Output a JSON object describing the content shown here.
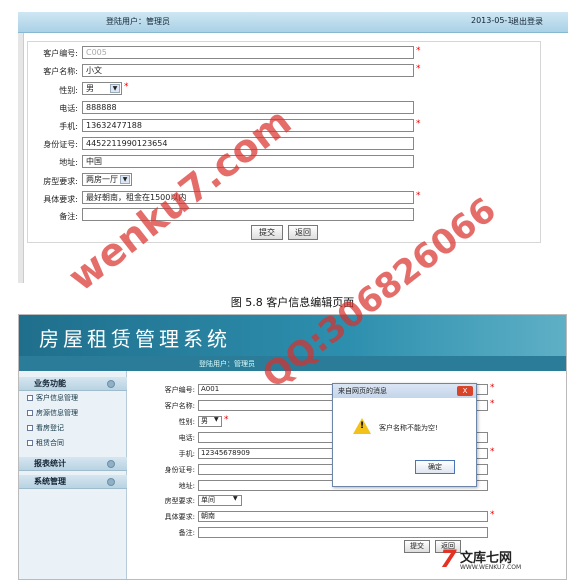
{
  "top_screenshot": {
    "header": {
      "user": "登陆用户：管理员",
      "date": "2013-05-1",
      "logout": "退出登录"
    },
    "fields": [
      {
        "label": "客户编号:",
        "value": "C005",
        "required": true
      },
      {
        "label": "客户名称:",
        "value": "小文",
        "required": true
      },
      {
        "label": "性别:",
        "value": "男",
        "required": true,
        "type": "select"
      },
      {
        "label": "电话:",
        "value": "888888",
        "required": false
      },
      {
        "label": "手机:",
        "value": "13632477188",
        "required": true
      },
      {
        "label": "身份证号:",
        "value": "4452211990123654",
        "required": false
      },
      {
        "label": "地址:",
        "value": "中国",
        "required": false
      },
      {
        "label": "房型要求:",
        "value": "两房一厅",
        "required": false,
        "type": "select"
      },
      {
        "label": "具体要求:",
        "value": "最好朝南，租金在1500以内",
        "required": true
      },
      {
        "label": "备注:",
        "value": "",
        "required": false
      }
    ],
    "buttons": {
      "submit": "提交",
      "back": "返回"
    }
  },
  "caption": "图 5.8 客户信息编辑页面",
  "bottom_screenshot": {
    "app_title": "房屋租赁管理系统",
    "user": "登陆用户：管理员",
    "sidebar": {
      "sections": [
        {
          "label": "业务功能",
          "items": [
            "客户信息管理",
            "房源信息管理",
            "看房登记",
            "租赁合同"
          ]
        },
        {
          "label": "报表统计",
          "items": []
        },
        {
          "label": "系统管理",
          "items": []
        }
      ]
    },
    "fields": [
      {
        "label": "客户编号:",
        "value": "A001",
        "required": true
      },
      {
        "label": "客户名称:",
        "value": "",
        "required": true
      },
      {
        "label": "性别:",
        "value": "男",
        "required": true
      },
      {
        "label": "电话:",
        "value": "",
        "required": false
      },
      {
        "label": "手机:",
        "value": "12345678909",
        "required": true
      },
      {
        "label": "身份证号:",
        "value": "",
        "required": false
      },
      {
        "label": "地址:",
        "value": "",
        "required": false
      },
      {
        "label": "房型要求:",
        "value": "单间",
        "required": false
      },
      {
        "label": "具体要求:",
        "value": "朝南",
        "required": true
      },
      {
        "label": "备注:",
        "value": "",
        "required": false
      }
    ],
    "buttons": {
      "submit": "提交",
      "back": "返回"
    },
    "dialog": {
      "title": "来自网页的消息",
      "message": "客户名称不能为空!",
      "ok": "确定",
      "close": "X"
    }
  },
  "watermark": {
    "site": "wenku7.com",
    "qq": "QQ:306826066"
  },
  "logo": {
    "text": "文库七网",
    "url": "WWW.WENKU7.COM",
    "mark": "7"
  }
}
